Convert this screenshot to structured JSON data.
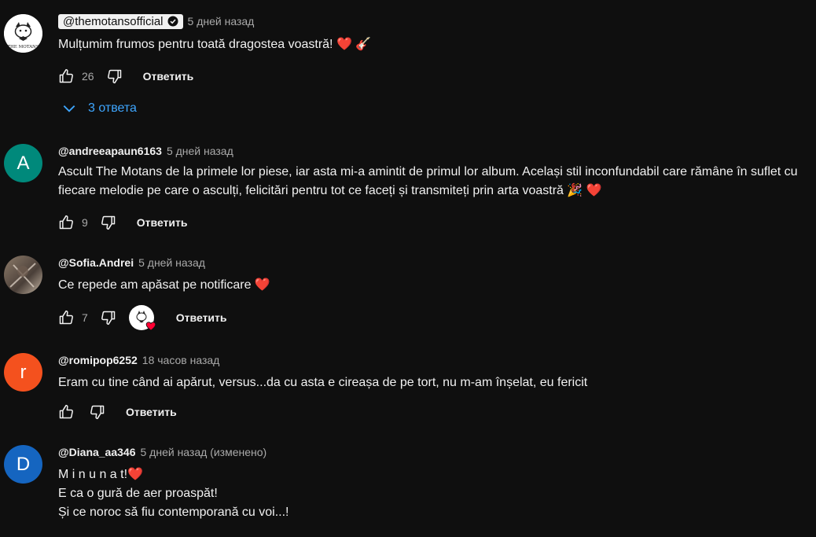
{
  "comments": [
    {
      "author": "@themotansofficial",
      "time": "5 дней назад",
      "text": "Mulțumim frumos pentru toată dragostea voastră! ❤️ 🎸",
      "likes": "26",
      "reply": "Ответить",
      "avatar_text": "THE MOTANS",
      "replies_label": "3 ответа"
    },
    {
      "author": "@andreeapaun6163",
      "time": "5 дней назад",
      "text": "Ascult The Motans de la primele lor piese, iar asta mi-a amintit de primul lor album. Același stil inconfundabil care rămâne în suflet cu fiecare melodie pe care o asculți, felicitări pentru tot ce faceți și transmiteți prin arta voastră 🎉 ❤️",
      "likes": "9",
      "reply": "Ответить",
      "avatar_letter": "A",
      "avatar_color": "#00897b"
    },
    {
      "author": "@Sofia.Andrei",
      "time": "5 дней назад",
      "text": "Ce repede am apăsat pe notificare ❤️",
      "likes": "7",
      "reply": "Ответить"
    },
    {
      "author": "@romipop6252",
      "time": "18 часов назад",
      "text": "Eram cu tine când ai apărut, versus...da cu asta e cireașa de pe tort, nu m-am înșelat, eu fericit",
      "reply": "Ответить",
      "avatar_letter": "r",
      "avatar_color": "#f4511e"
    },
    {
      "author": "@Diana_aa346",
      "time": "5 дней назад (изменено)",
      "text": "M i n u n a t!❤️\nE ca o gură de aer proaspăt!\nȘi ce noroc să fiu contemporană cu voi...!",
      "avatar_letter": "D",
      "avatar_color": "#1565c0"
    }
  ],
  "colors": {
    "background": "#0f0f0f",
    "text": "#f1f1f1",
    "secondary": "#aaaaaa",
    "link": "#3ea6ff"
  }
}
